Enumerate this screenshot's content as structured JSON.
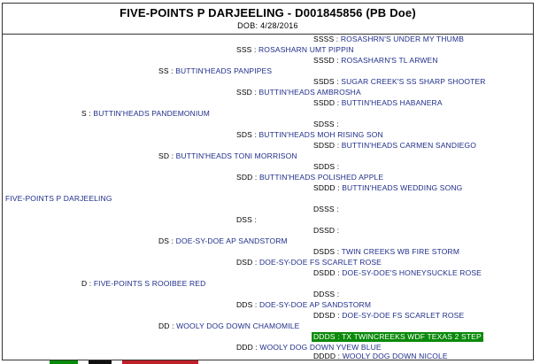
{
  "header": {
    "title": "FIVE-POINTS P DARJEELING - D001845856 (PB Doe)",
    "dob": "DOB: 4/28/2016"
  },
  "pedigree": {
    "subject": "FIVE-POINTS P DARJEELING",
    "entries": [
      {
        "code": "SSSS",
        "name": "ROSASHRN'S UNDER MY THUMB"
      },
      {
        "code": "SSS",
        "name": "ROSASHARN UMT PIPPIN"
      },
      {
        "code": "SSSD",
        "name": "ROSASHARN'S TL ARWEN"
      },
      {
        "code": "SS",
        "name": "BUTTIN'HEADS PANPIPES"
      },
      {
        "code": "SSDS",
        "name": "SUGAR CREEK'S SS SHARP SHOOTER"
      },
      {
        "code": "SSD",
        "name": "BUTTIN'HEADS AMBROSHA"
      },
      {
        "code": "SSDD",
        "name": "BUTTIN'HEADS HABANERA"
      },
      {
        "code": "S",
        "name": "BUTTIN'HEADS PANDEMONIUM"
      },
      {
        "code": "SDSS",
        "name": ""
      },
      {
        "code": "SDS",
        "name": "BUTTIN'HEADS MOH RISING SON"
      },
      {
        "code": "SDSD",
        "name": "BUTTIN'HEADS CARMEN SANDIEGO"
      },
      {
        "code": "SD",
        "name": "BUTTIN'HEADS TONI MORRISON"
      },
      {
        "code": "SDDS",
        "name": ""
      },
      {
        "code": "SDD",
        "name": "BUTTIN'HEADS POLISHED APPLE"
      },
      {
        "code": "SDDD",
        "name": "BUTTIN'HEADS WEDDING SONG"
      },
      {
        "code": "DSSS",
        "name": ""
      },
      {
        "code": "DSS",
        "name": ""
      },
      {
        "code": "DSSD",
        "name": ""
      },
      {
        "code": "DS",
        "name": "DOE-SY-DOE AP SANDSTORM"
      },
      {
        "code": "DSDS",
        "name": "TWIN CREEKS WB FIRE STORM"
      },
      {
        "code": "DSD",
        "name": "DOE-SY-DOE FS SCARLET ROSE"
      },
      {
        "code": "DSDD",
        "name": "DOE-SY-DOE'S HONEYSUCKLE ROSE"
      },
      {
        "code": "D",
        "name": "FIVE-POINTS S ROOIBEE RED"
      },
      {
        "code": "DDSS",
        "name": ""
      },
      {
        "code": "DDS",
        "name": "DOE-SY-DOE AP SANDSTORM"
      },
      {
        "code": "DDSD",
        "name": "DOE-SY-DOE FS SCARLET ROSE"
      },
      {
        "code": "DD",
        "name": "WOOLY DOG DOWN CHAMOMILE"
      },
      {
        "code": "DDDS",
        "name": "TX TWINCREEKS WDF TEXAS 2 STEP"
      },
      {
        "code": "DDD",
        "name": "WOOLY DOG DOWN YVEW BLUE"
      },
      {
        "code": "DDDD",
        "name": "WOOLY DOG DOWN NICOLE"
      }
    ],
    "separator": " : "
  },
  "colors": {
    "name_text": "#1f2e8a",
    "highlight_bg": "#0a8a0a",
    "footer_green": "#0a8a0a",
    "footer_black": "#111111",
    "footer_red": "#c0202a"
  }
}
